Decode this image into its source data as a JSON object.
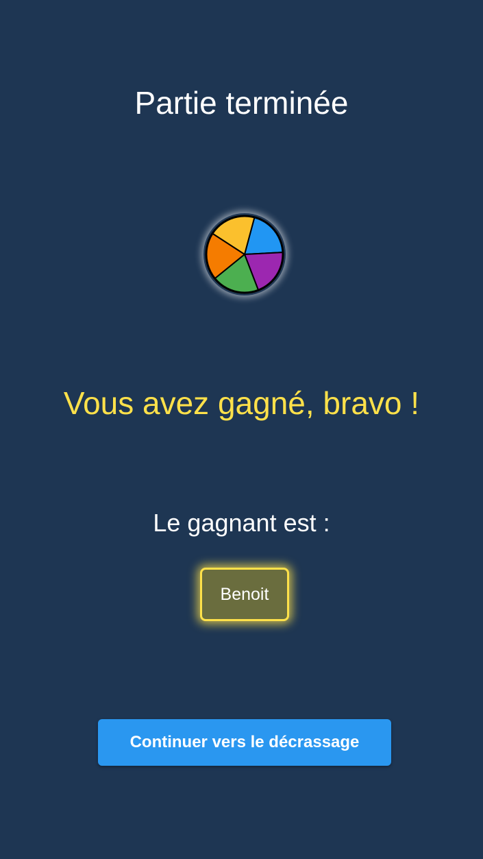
{
  "screen": {
    "title": "Partie terminée",
    "win_message": "Vous avez gagné, bravo !",
    "winner_label": "Le gagnant est :",
    "winner_name": "Benoit",
    "continue_button": "Continuer vers le décrassage"
  },
  "wheel": {
    "icon": "pie-wheel-icon",
    "segments": [
      {
        "color": "#2196f3"
      },
      {
        "color": "#9c27b0"
      },
      {
        "color": "#4caf50"
      },
      {
        "color": "#f57c00"
      },
      {
        "color": "#fbc02d"
      }
    ]
  },
  "colors": {
    "background": "#1e3653",
    "accent_yellow": "#ffe14a",
    "button_blue": "#2a97f0",
    "winner_chip": "#6a6d3e"
  }
}
